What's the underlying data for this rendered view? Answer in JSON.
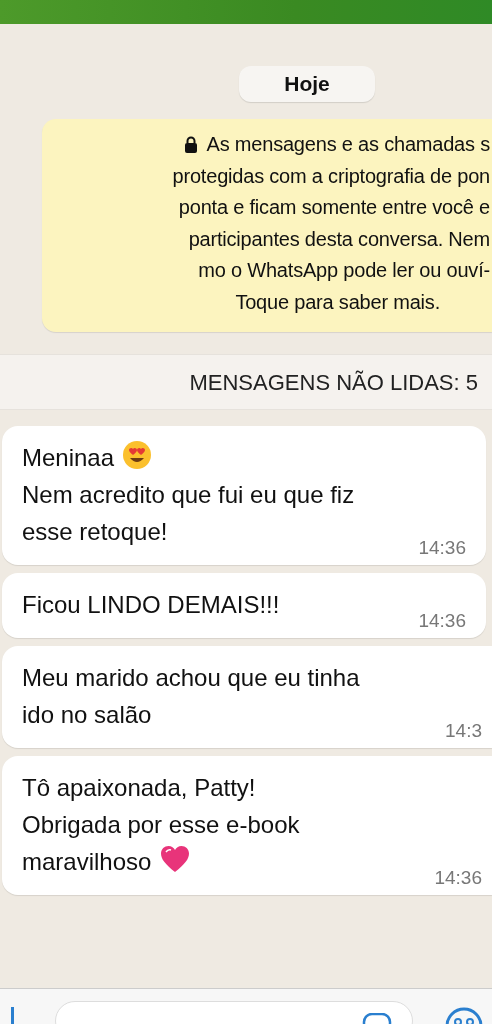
{
  "date_chip": "Hoje",
  "encryption_notice": {
    "lines": [
      "As mensagens e as chamadas s",
      "protegidas com a criptografia de pon",
      "ponta e ficam somente entre você e",
      "participantes desta conversa. Nem",
      "mo o WhatsApp pode ler ou ouví-",
      "Toque para saber mais."
    ]
  },
  "unread_banner": "MENSAGENS NÃO LIDAS: 5",
  "messages": [
    {
      "lines": [
        {
          "text": "Meninaa",
          "kind": "hearteyes"
        },
        {
          "text": "Nem acredito que fui eu que fiz",
          "kind": "plain"
        },
        {
          "text": "esse retoque!",
          "kind": "plain"
        }
      ],
      "time": "14:36",
      "clipped": false
    },
    {
      "lines": [
        {
          "text": "Ficou LINDO DEMAIS!!!",
          "kind": "plain"
        }
      ],
      "time": "14:36",
      "clipped": false
    },
    {
      "lines": [
        {
          "text": "Meu marido achou que eu tinha",
          "kind": "plain"
        },
        {
          "text": "ido no salão",
          "kind": "plain"
        }
      ],
      "time": "14:3",
      "clipped": true
    },
    {
      "lines": [
        {
          "text": "Tô apaixonada, Patty!",
          "kind": "plain"
        },
        {
          "text": "Obrigada por esse e-book",
          "kind": "plain"
        },
        {
          "text": "maravilhoso",
          "kind": "heart"
        }
      ],
      "time": "14:36",
      "clipped": true
    }
  ]
}
